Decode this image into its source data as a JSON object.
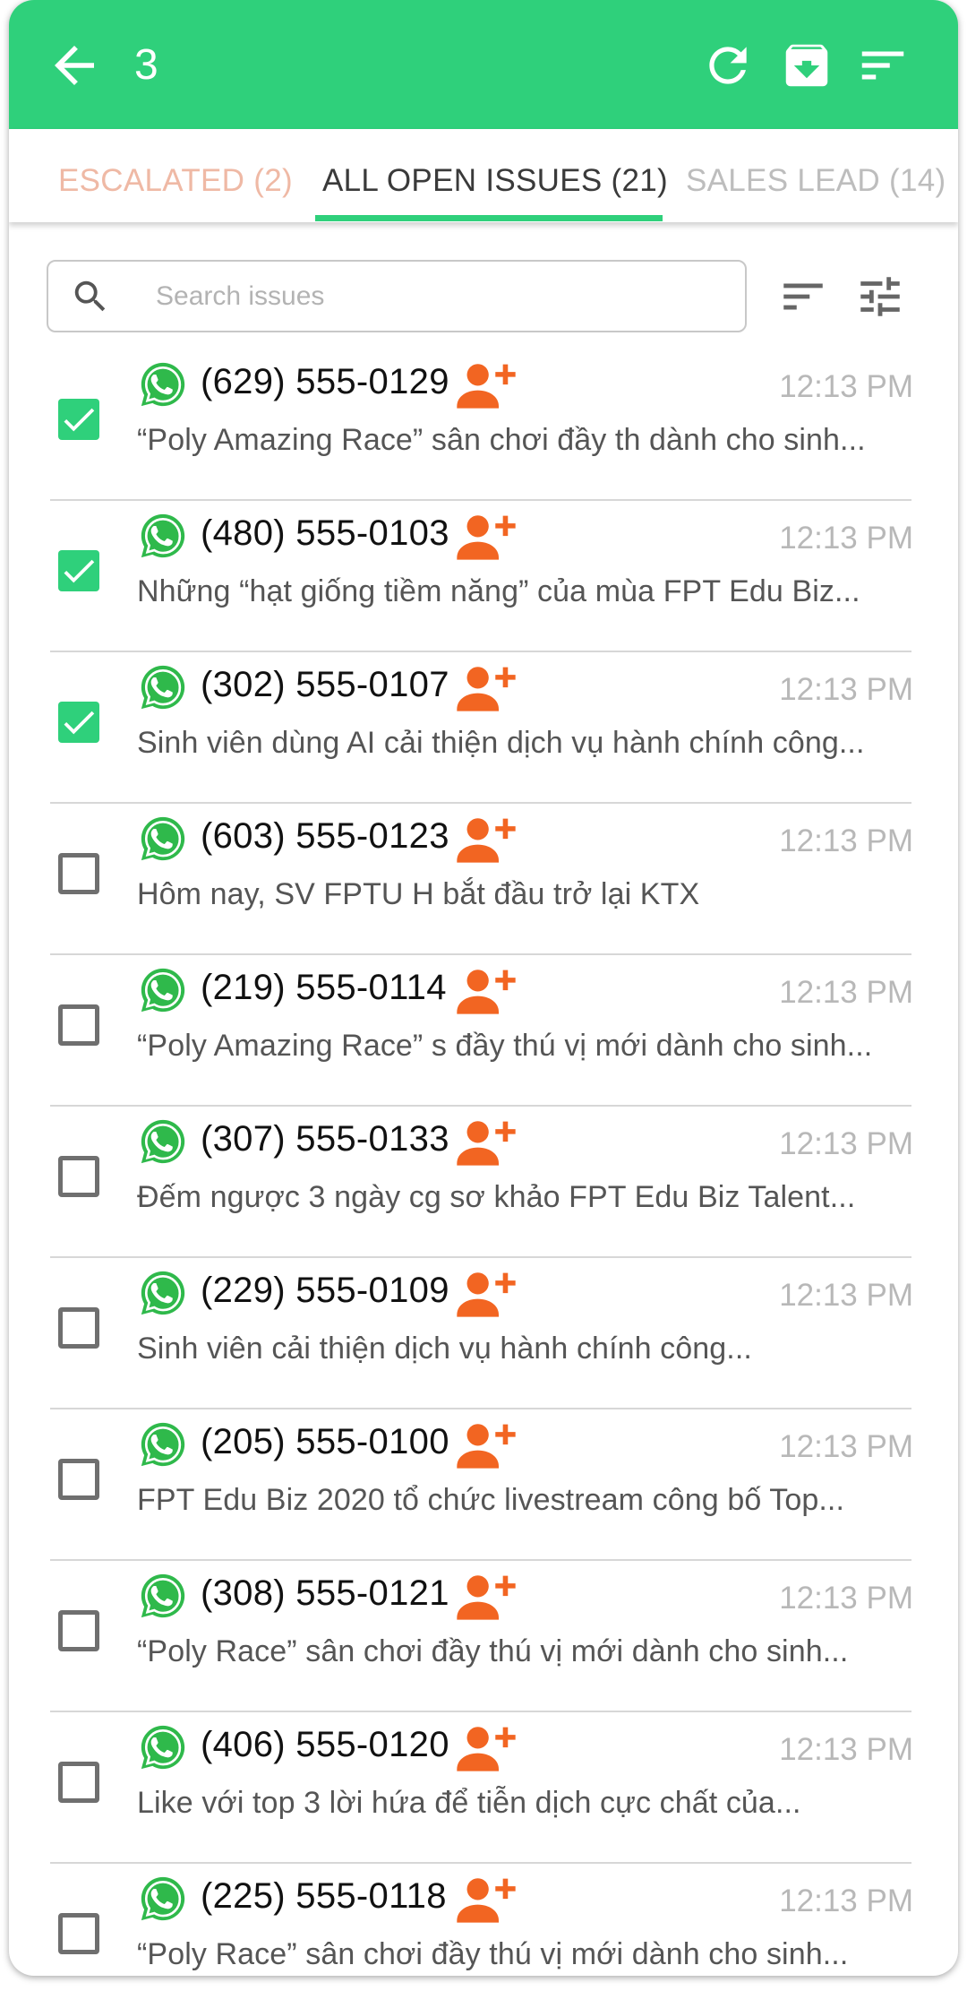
{
  "header": {
    "title": "3",
    "bg_color": "#2fd07b"
  },
  "tabs": [
    {
      "label": "ESCALATED (2)",
      "active": false
    },
    {
      "label": "ALL OPEN ISSUES (21)",
      "active": true
    },
    {
      "label": "SALES LEAD (14)",
      "active": false
    }
  ],
  "search": {
    "placeholder": "Search issues",
    "value": ""
  },
  "colors": {
    "accent": "#2fd07b",
    "whatsapp": "#2fb94b",
    "add_person": "#f26522"
  },
  "issues": [
    {
      "phone": "(629) 555-0129",
      "time": "12:13 PM",
      "preview": "“Poly Amazing Race” sân chơi đầy th dành cho sinh...",
      "checked": true
    },
    {
      "phone": "(480) 555-0103",
      "time": "12:13 PM",
      "preview": "Những “hạt giống tiềm năng” của mùa FPT Edu Biz...",
      "checked": true
    },
    {
      "phone": "(302) 555-0107",
      "time": "12:13 PM",
      "preview": "Sinh viên dùng AI cải thiện dịch vụ hành chính công...",
      "checked": true
    },
    {
      "phone": "(603) 555-0123",
      "time": "12:13 PM",
      "preview": "Hôm nay, SV FPTU H bắt đầu trở lại KTX",
      "checked": false
    },
    {
      "phone": "(219) 555-0114",
      "time": "12:13 PM",
      "preview": "“Poly Amazing Race” s đầy thú vị mới dành cho sinh...",
      "checked": false
    },
    {
      "phone": "(307) 555-0133",
      "time": "12:13 PM",
      "preview": "Đếm ngược 3 ngày cg sơ khảo FPT Edu Biz Talent...",
      "checked": false
    },
    {
      "phone": "(229) 555-0109",
      "time": "12:13 PM",
      "preview": "Sinh viên  cải thiện dịch vụ hành chính công...",
      "checked": false
    },
    {
      "phone": "(205) 555-0100",
      "time": "12:13 PM",
      "preview": "FPT Edu Biz 2020 tổ chức livestream công bố Top...",
      "checked": false
    },
    {
      "phone": "(308) 555-0121",
      "time": "12:13 PM",
      "preview": "“Poly  Race” sân chơi đầy thú vị mới dành cho sinh...",
      "checked": false
    },
    {
      "phone": "(406) 555-0120",
      "time": "12:13 PM",
      "preview": "Like  với top 3 lời hứa để tiễn dịch cực chất của...",
      "checked": false
    },
    {
      "phone": "(225) 555-0118",
      "time": "12:13 PM",
      "preview": "“Poly  Race” sân chơi đầy thú vị mới dành cho sinh...",
      "checked": false
    }
  ]
}
